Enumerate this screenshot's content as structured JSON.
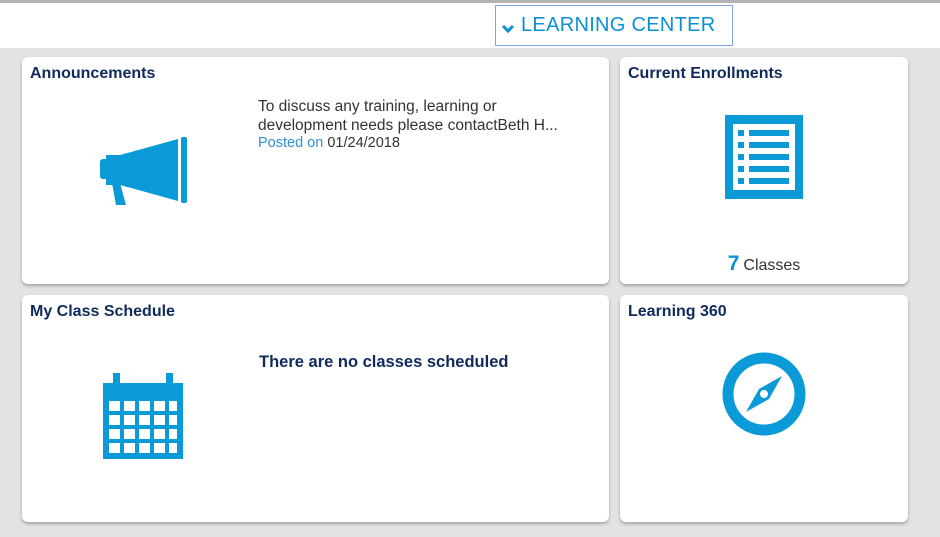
{
  "header": {
    "nav_label": "LEARNING CENTER",
    "nav_icon": "chevron-down-icon",
    "accent_color": "#0b8fd6"
  },
  "tiles": {
    "announcements": {
      "title": "Announcements",
      "icon": "megaphone-icon",
      "message": "To discuss any training, learning or development needs please contactBeth H...",
      "posted_label": "Posted on",
      "posted_date": "01/24/2018"
    },
    "current_enrollments": {
      "title": "Current Enrollments",
      "icon": "list-icon",
      "count": "7",
      "count_label": "Classes"
    },
    "class_schedule": {
      "title": "My Class Schedule",
      "icon": "calendar-icon",
      "empty_message": "There are no classes scheduled"
    },
    "learning_360": {
      "title": "Learning 360",
      "icon": "compass-icon"
    }
  }
}
